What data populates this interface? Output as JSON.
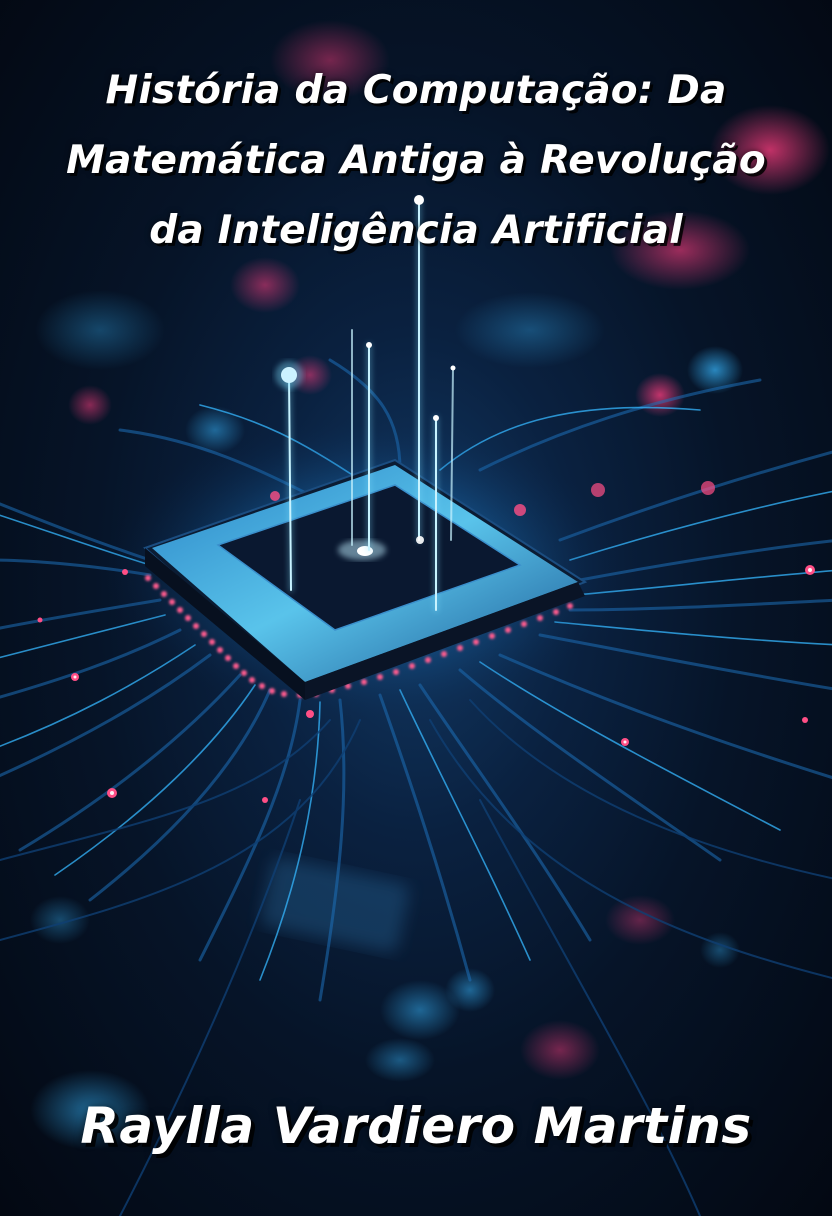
{
  "cover": {
    "title_lines": [
      "História da Computação: Da",
      "Matemática Antiga à Revolução",
      "da Inteligência Artificial"
    ],
    "author": "Raylla Vardiero Martins"
  },
  "colors": {
    "background": "#050b18",
    "circuit_glow": "#2fb6ff",
    "accent_pink": "#ff3d7f",
    "text": "#ffffff"
  },
  "illustration": {
    "subject": "glowing-microchip-circuit-board"
  }
}
